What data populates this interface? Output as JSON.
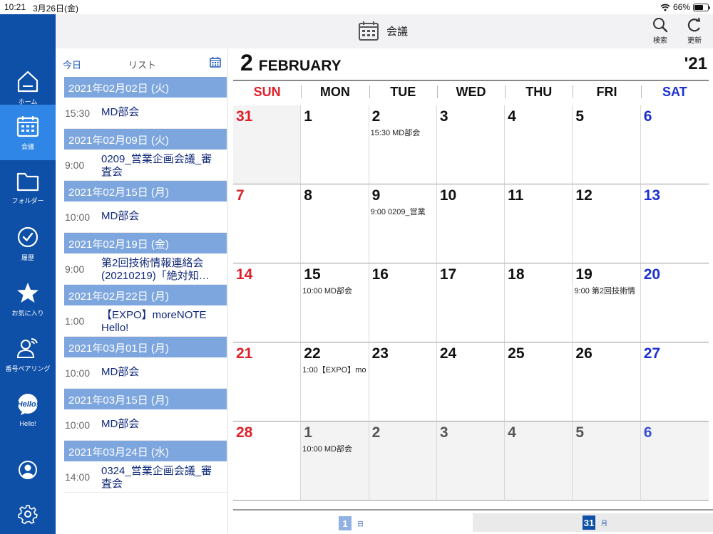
{
  "status": {
    "time": "10:21",
    "date": "3月26日(金)",
    "battery": "66%"
  },
  "nav": [
    {
      "label": "ホーム",
      "icon": "home-icon",
      "active": false
    },
    {
      "label": "会議",
      "icon": "calendar-icon",
      "active": true
    },
    {
      "label": "フォルダー",
      "icon": "folder-icon",
      "active": false
    },
    {
      "label": "履歴",
      "icon": "history-icon",
      "active": false
    },
    {
      "label": "お気に入り",
      "icon": "star-icon",
      "active": false
    },
    {
      "label": "番号ペアリング",
      "icon": "pairing-icon",
      "active": false
    },
    {
      "label": "Hello!",
      "icon": "hello-icon",
      "active": false
    }
  ],
  "header": {
    "title": "会議",
    "search_label": "検索",
    "refresh_label": "更新"
  },
  "list": {
    "today_label": "今日",
    "list_label": "リスト",
    "groups": [
      {
        "date": "2021年02月02日 (火)",
        "time": "15:30",
        "title": "MD部会"
      },
      {
        "date": "2021年02月09日 (火)",
        "time": "9:00",
        "title": "0209_営業企画会議_審査会"
      },
      {
        "date": "2021年02月15日 (月)",
        "time": "10:00",
        "title": "MD部会"
      },
      {
        "date": "2021年02月19日 (金)",
        "time": "9:00",
        "title": "第2回技術情報連絡会(20210219)「絶対知…"
      },
      {
        "date": "2021年02月22日 (月)",
        "time": "1:00",
        "title": "【EXPO】moreNOTE Hello!"
      },
      {
        "date": "2021年03月01日 (月)",
        "time": "10:00",
        "title": "MD部会"
      },
      {
        "date": "2021年03月15日 (月)",
        "time": "10:00",
        "title": "MD部会"
      },
      {
        "date": "2021年03月24日 (水)",
        "time": "14:00",
        "title": "0324_営業企画会議_審査会"
      }
    ]
  },
  "calendar": {
    "month_num": "2",
    "month_name": "FEBRUARY",
    "year": "'21",
    "weekdays": [
      "SUN",
      "MON",
      "TUE",
      "WED",
      "THU",
      "FRI",
      "SAT"
    ],
    "days": [
      {
        "d": "31",
        "other": true,
        "event": ""
      },
      {
        "d": "1",
        "other": false,
        "event": ""
      },
      {
        "d": "2",
        "other": false,
        "event": "15:30 MD部会"
      },
      {
        "d": "3",
        "other": false,
        "event": ""
      },
      {
        "d": "4",
        "other": false,
        "event": ""
      },
      {
        "d": "5",
        "other": false,
        "event": ""
      },
      {
        "d": "6",
        "other": false,
        "event": ""
      },
      {
        "d": "7",
        "other": false,
        "event": ""
      },
      {
        "d": "8",
        "other": false,
        "event": ""
      },
      {
        "d": "9",
        "other": false,
        "event": "9:00 0209_営業"
      },
      {
        "d": "10",
        "other": false,
        "event": ""
      },
      {
        "d": "11",
        "other": false,
        "event": ""
      },
      {
        "d": "12",
        "other": false,
        "event": ""
      },
      {
        "d": "13",
        "other": false,
        "event": ""
      },
      {
        "d": "14",
        "other": false,
        "event": ""
      },
      {
        "d": "15",
        "other": false,
        "event": "10:00 MD部会"
      },
      {
        "d": "16",
        "other": false,
        "event": ""
      },
      {
        "d": "17",
        "other": false,
        "event": ""
      },
      {
        "d": "18",
        "other": false,
        "event": ""
      },
      {
        "d": "19",
        "other": false,
        "event": "9:00 第2回技術情"
      },
      {
        "d": "20",
        "other": false,
        "event": ""
      },
      {
        "d": "21",
        "other": false,
        "event": ""
      },
      {
        "d": "22",
        "other": false,
        "event": "1:00【EXPO】mo"
      },
      {
        "d": "23",
        "other": false,
        "event": ""
      },
      {
        "d": "24",
        "other": false,
        "event": ""
      },
      {
        "d": "25",
        "other": false,
        "event": ""
      },
      {
        "d": "26",
        "other": false,
        "event": ""
      },
      {
        "d": "27",
        "other": false,
        "event": ""
      },
      {
        "d": "28",
        "other": false,
        "event": ""
      },
      {
        "d": "1",
        "other": true,
        "event": "10:00 MD部会"
      },
      {
        "d": "2",
        "other": true,
        "event": ""
      },
      {
        "d": "3",
        "other": true,
        "event": ""
      },
      {
        "d": "4",
        "other": true,
        "event": ""
      },
      {
        "d": "5",
        "other": true,
        "event": ""
      },
      {
        "d": "6",
        "other": true,
        "event": ""
      }
    ]
  },
  "bottom": {
    "day_box": "1",
    "day_label": "日",
    "month_box": "31",
    "month_label": "月"
  },
  "colors": {
    "sidebar": "#0e4fa8",
    "sidebar_active": "#2f86e6",
    "date_header": "#7da6de",
    "sunday": "#e0202a",
    "saturday": "#1a2fd0",
    "accent": "#1a56b8"
  }
}
